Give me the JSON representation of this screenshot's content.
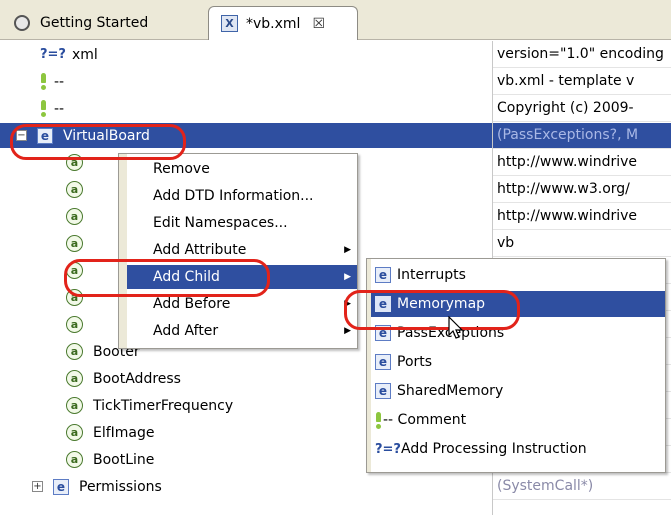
{
  "tabs": [
    {
      "label": "Getting Started",
      "icon": "globe-icon",
      "active": false
    },
    {
      "label": "*vb.xml",
      "icon": "xml-file-icon",
      "active": true,
      "close_symbol": "☒"
    }
  ],
  "tree_rows": [
    {
      "icon": "?=?",
      "label": "xml",
      "value": "version=\"1.0\" encoding",
      "indent": 40
    },
    {
      "icon": "comment",
      "label": "--",
      "value": "vb.xml - template v",
      "indent": 40
    },
    {
      "icon": "comment",
      "label": "--",
      "value": "Copyright (c) 2009-",
      "indent": 40
    },
    {
      "icon": "element",
      "label": "VirtualBoard",
      "value": "(PassExceptions?, M",
      "indent": 16,
      "selected": true,
      "expander": "−"
    },
    {
      "icon": "attribute",
      "label": "",
      "value": "http://www.windrive",
      "indent": 66
    },
    {
      "icon": "attribute",
      "label": "",
      "value": "http://www.w3.org/",
      "indent": 66
    },
    {
      "icon": "attribute",
      "label": "",
      "value": "http://www.windrive",
      "indent": 66
    },
    {
      "icon": "attribute",
      "label": "",
      "value": "vb",
      "indent": 66
    },
    {
      "icon": "attribute",
      "label": "",
      "value": "",
      "indent": 66
    },
    {
      "icon": "attribute",
      "label": "",
      "value": "",
      "indent": 66
    },
    {
      "icon": "attribute",
      "label": "",
      "value": "",
      "indent": 66
    },
    {
      "icon": "attribute",
      "label": "Booter",
      "value": "",
      "indent": 66
    },
    {
      "icon": "attribute",
      "label": "BootAddress",
      "value": "",
      "indent": 66
    },
    {
      "icon": "attribute",
      "label": "TickTimerFrequency",
      "value": "",
      "indent": 66
    },
    {
      "icon": "attribute",
      "label": "ElfImage",
      "value": "",
      "indent": 66
    },
    {
      "icon": "attribute",
      "label": "BootLine",
      "value": "",
      "indent": 66
    },
    {
      "icon": "element",
      "label": "Permissions",
      "value": "(SystemCall*)",
      "indent": 32,
      "expander": "+"
    }
  ],
  "context_menu": [
    {
      "label": "Remove",
      "submenu": false
    },
    {
      "label": "Add DTD Information...",
      "submenu": false
    },
    {
      "label": "Edit Namespaces...",
      "submenu": false
    },
    {
      "label": "Add Attribute",
      "submenu": true
    },
    {
      "label": "Add Child",
      "submenu": true,
      "highlighted": true
    },
    {
      "label": "Add Before",
      "submenu": true
    },
    {
      "label": "Add After",
      "submenu": true
    }
  ],
  "submenu": [
    {
      "icon": "element",
      "label": "Interrupts"
    },
    {
      "icon": "element",
      "label": "Memorymap",
      "highlighted": true
    },
    {
      "icon": "element",
      "label": "PassExceptions"
    },
    {
      "icon": "element",
      "label": "Ports"
    },
    {
      "icon": "element",
      "label": "SharedMemory"
    },
    {
      "icon": "comment",
      "label": "-- Comment"
    },
    {
      "icon": "?=?",
      "label": "Add Processing Instruction"
    }
  ],
  "colors": {
    "selection": "#2f4fa0",
    "annotation_ring": "#e2231a",
    "value_grey": "#8a8aa8"
  }
}
